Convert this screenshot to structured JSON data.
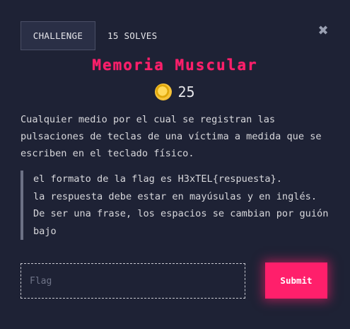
{
  "header": {
    "challenge_tab": "CHALLENGE",
    "solves": "15 SOLVES",
    "close_symbol": "✖"
  },
  "challenge": {
    "title": "Memoria Muscular",
    "points": "25",
    "points_icon": "coin-icon",
    "description": "Cualquier medio por el cual se registran las pulsaciones de teclas de una víctima a medida que se escriben en el teclado físico.",
    "notes": [
      "el formato de la flag es H3xTEL{respuesta}.",
      "la respuesta debe estar en mayúsulas y en inglés.",
      "De ser una frase, los espacios se cambian por guión bajo"
    ]
  },
  "form": {
    "flag_placeholder": "Flag",
    "flag_value": "",
    "submit_label": "Submit"
  },
  "colors": {
    "background": "#1e2235",
    "accent": "#ff1f6b",
    "tab_background": "#2a2f46"
  }
}
